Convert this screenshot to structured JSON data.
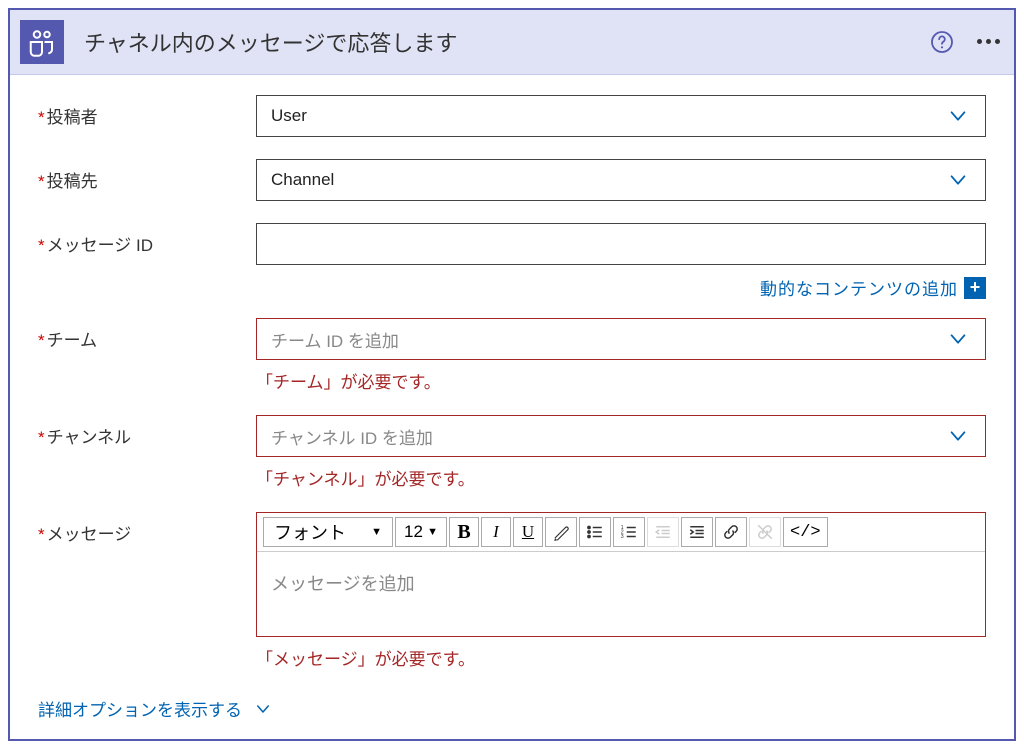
{
  "header": {
    "title": "チャネル内のメッセージで応答します"
  },
  "fields": {
    "poster": {
      "label": "投稿者",
      "value": "User"
    },
    "postTo": {
      "label": "投稿先",
      "value": "Channel"
    },
    "messageId": {
      "label": "メッセージ ID",
      "value": ""
    },
    "team": {
      "label": "チーム",
      "placeholder": "チーム ID を追加",
      "error": "「チーム」が必要です。"
    },
    "channel": {
      "label": "チャンネル",
      "placeholder": "チャンネル ID を追加",
      "error": "「チャンネル」が必要です。"
    },
    "message": {
      "label": "メッセージ",
      "placeholder": "メッセージを追加",
      "error": "「メッセージ」が必要です。"
    }
  },
  "dynamicContentLink": "動的なコンテンツの追加",
  "rte": {
    "font": "フォント",
    "size": "12"
  },
  "advancedOptions": "詳細オプションを表示する"
}
